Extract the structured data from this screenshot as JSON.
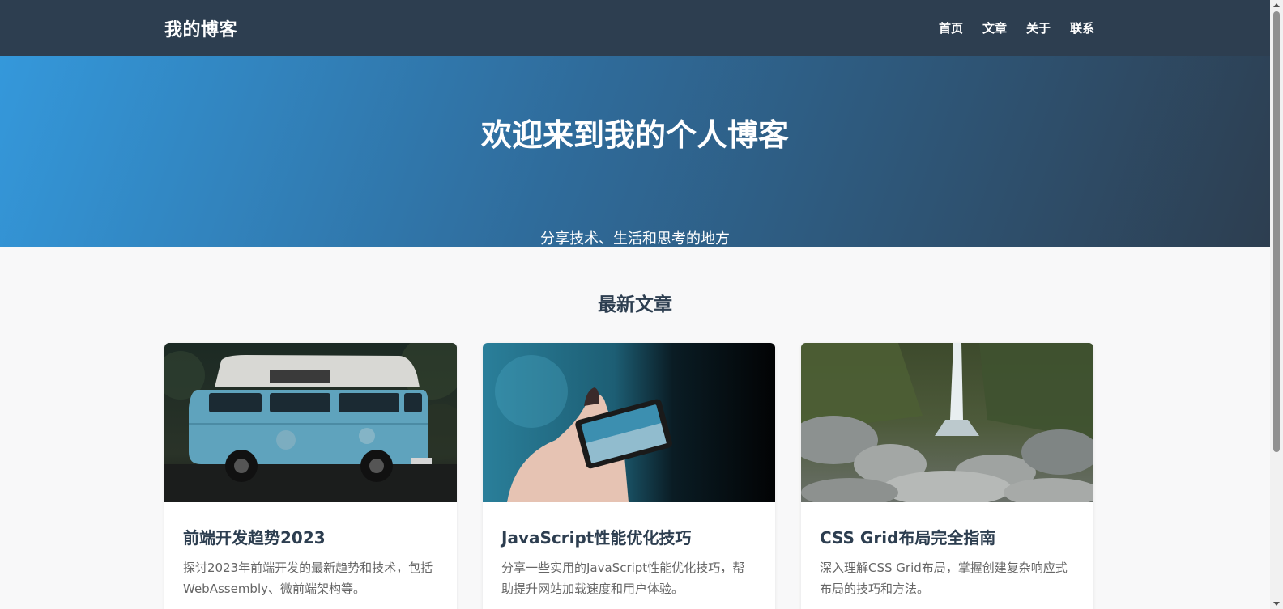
{
  "header": {
    "logo": "我的博客",
    "nav": [
      "首页",
      "文章",
      "关于",
      "联系"
    ]
  },
  "hero": {
    "title": "欢迎来到我的个人博客",
    "subtitle": "分享技术、生活和思考的地方"
  },
  "section": {
    "title": "最新文章"
  },
  "articles": [
    {
      "title": "前端开发趋势2023",
      "desc": "探讨2023年前端开发的最新趋势和技术，包括WebAssembly、微前端架构等。",
      "image": "blue-van-photo"
    },
    {
      "title": "JavaScript性能优化技巧",
      "desc": "分享一些实用的JavaScript性能优化技巧，帮助提升网站加载速度和用户体验。",
      "image": "phone-photography-photo"
    },
    {
      "title": "CSS Grid布局完全指南",
      "desc": "深入理解CSS Grid布局，掌握创建复杂响应式布局的技巧和方法。",
      "image": "waterfall-rocks-photo"
    }
  ],
  "colors": {
    "header_bg": "#2d3e50",
    "hero_start": "#3498db",
    "hero_end": "#2d3e50",
    "page_bg": "#f8f8f9"
  }
}
